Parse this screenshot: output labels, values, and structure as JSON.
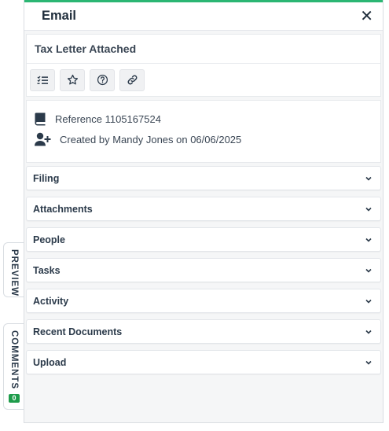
{
  "side_tabs": {
    "preview": "PREVIEW",
    "comments": "COMMENTS",
    "comments_count": "0"
  },
  "panel": {
    "title": "Email",
    "close_glyph": "✕",
    "subject": "Tax Letter Attached"
  },
  "toolbar": {
    "buttons": [
      {
        "name": "checklist-icon"
      },
      {
        "name": "star-icon"
      },
      {
        "name": "help-icon"
      },
      {
        "name": "link-icon"
      }
    ]
  },
  "info": {
    "reference": "Reference 1105167524",
    "created": "Created by Mandy Jones on 06/06/2025"
  },
  "sections": [
    {
      "label": "Filing"
    },
    {
      "label": "Attachments"
    },
    {
      "label": "People"
    },
    {
      "label": "Tasks"
    },
    {
      "label": "Activity"
    },
    {
      "label": "Recent Documents"
    },
    {
      "label": "Upload"
    }
  ],
  "colors": {
    "accent": "#2bb673",
    "badge": "#1e9c4b",
    "text": "#2b3a4a"
  }
}
